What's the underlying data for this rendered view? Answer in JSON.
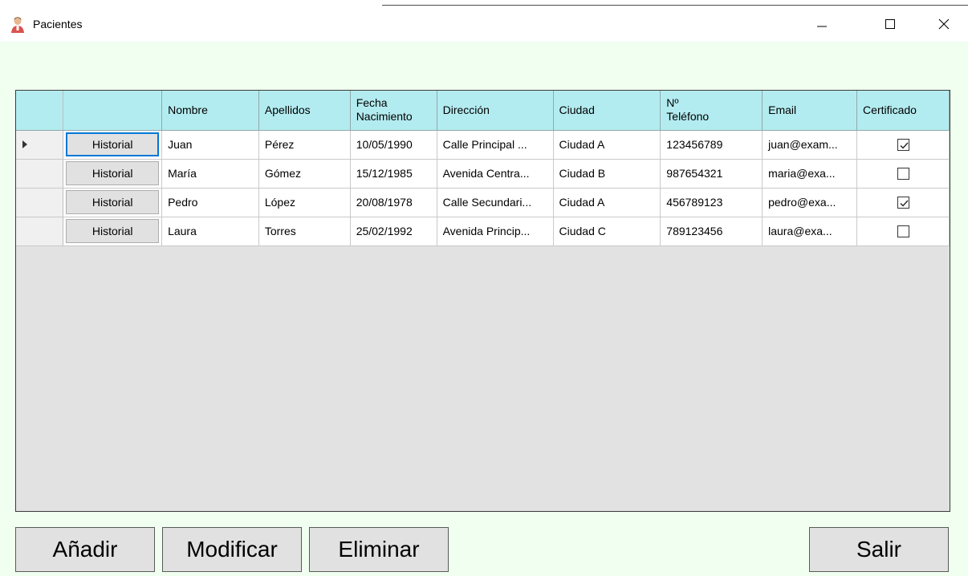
{
  "window": {
    "title": "Pacientes",
    "icon": "patient-user-icon"
  },
  "grid": {
    "columns": [
      "",
      "Nombre",
      "Apellidos",
      "Fecha Nacimiento",
      "Dirección",
      "Ciudad",
      "Nº Teléfono",
      "Email",
      "Certificado"
    ],
    "header_fecha_1": "Fecha",
    "header_fecha_2": "Nacimiento",
    "header_tel_1": "Nº",
    "header_tel_2": "Teléfono",
    "historial_label": "Historial",
    "rows": [
      {
        "nombre": "Juan",
        "apellidos": "Pérez",
        "fecha": "10/05/1990",
        "direccion": "Calle Principal ...",
        "ciudad": "Ciudad A",
        "telefono": "123456789",
        "email": "juan@exam...",
        "certificado": true
      },
      {
        "nombre": "María",
        "apellidos": "Gómez",
        "fecha": "15/12/1985",
        "direccion": "Avenida Centra...",
        "ciudad": "Ciudad B",
        "telefono": "987654321",
        "email": "maria@exa...",
        "certificado": false
      },
      {
        "nombre": "Pedro",
        "apellidos": "López",
        "fecha": "20/08/1978",
        "direccion": "Calle Secundari...",
        "ciudad": "Ciudad A",
        "telefono": "456789123",
        "email": "pedro@exa...",
        "certificado": true
      },
      {
        "nombre": "Laura",
        "apellidos": "Torres",
        "fecha": "25/02/1992",
        "direccion": "Avenida Princip...",
        "ciudad": "Ciudad C",
        "telefono": "789123456",
        "email": "laura@exa...",
        "certificado": false
      }
    ]
  },
  "buttons": {
    "add": "Añadir",
    "modify": "Modificar",
    "delete": "Eliminar",
    "exit": "Salir"
  },
  "colors": {
    "header_bg": "#b3ecf0",
    "client_bg": "#f0fff0",
    "grid_empty_bg": "#e2e2e2"
  }
}
